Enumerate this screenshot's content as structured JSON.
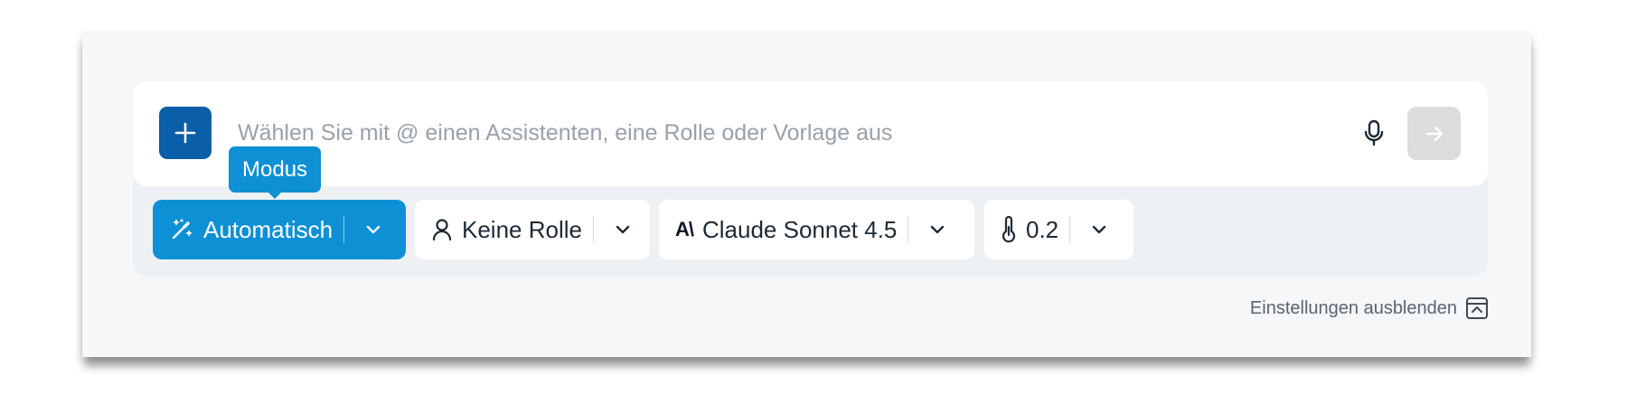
{
  "composer": {
    "add_icon": "plus-icon",
    "input_placeholder": "Wählen Sie mit @ einen Assistenten, eine Rolle oder Vorlage aus",
    "input_value": "",
    "mic_icon": "microphone-icon",
    "send_icon": "arrow-right-icon"
  },
  "tooltip": {
    "text": "Modus"
  },
  "toolbar": {
    "mode": {
      "icon": "magic-wand-icon",
      "label": "Automatisch",
      "caret_icon": "chevron-down-icon"
    },
    "role": {
      "icon": "user-icon",
      "label": "Keine Rolle",
      "caret_icon": "chevron-down-icon"
    },
    "model": {
      "logo_text": "A\\",
      "label": "Claude Sonnet 4.5",
      "caret_icon": "chevron-down-icon"
    },
    "temperature": {
      "icon": "thermometer-icon",
      "label": "0.2",
      "caret_icon": "chevron-down-icon"
    }
  },
  "footer": {
    "hide_settings_label": "Einstellungen ausblenden",
    "hide_settings_icon": "collapse-panel-icon"
  },
  "colors": {
    "accent": "#0d90d4",
    "add_button": "#0b5ea8",
    "send_disabled": "#dcdcdd",
    "card_background": "#f5f7f9",
    "toolbar_background": "#eef1f4"
  }
}
